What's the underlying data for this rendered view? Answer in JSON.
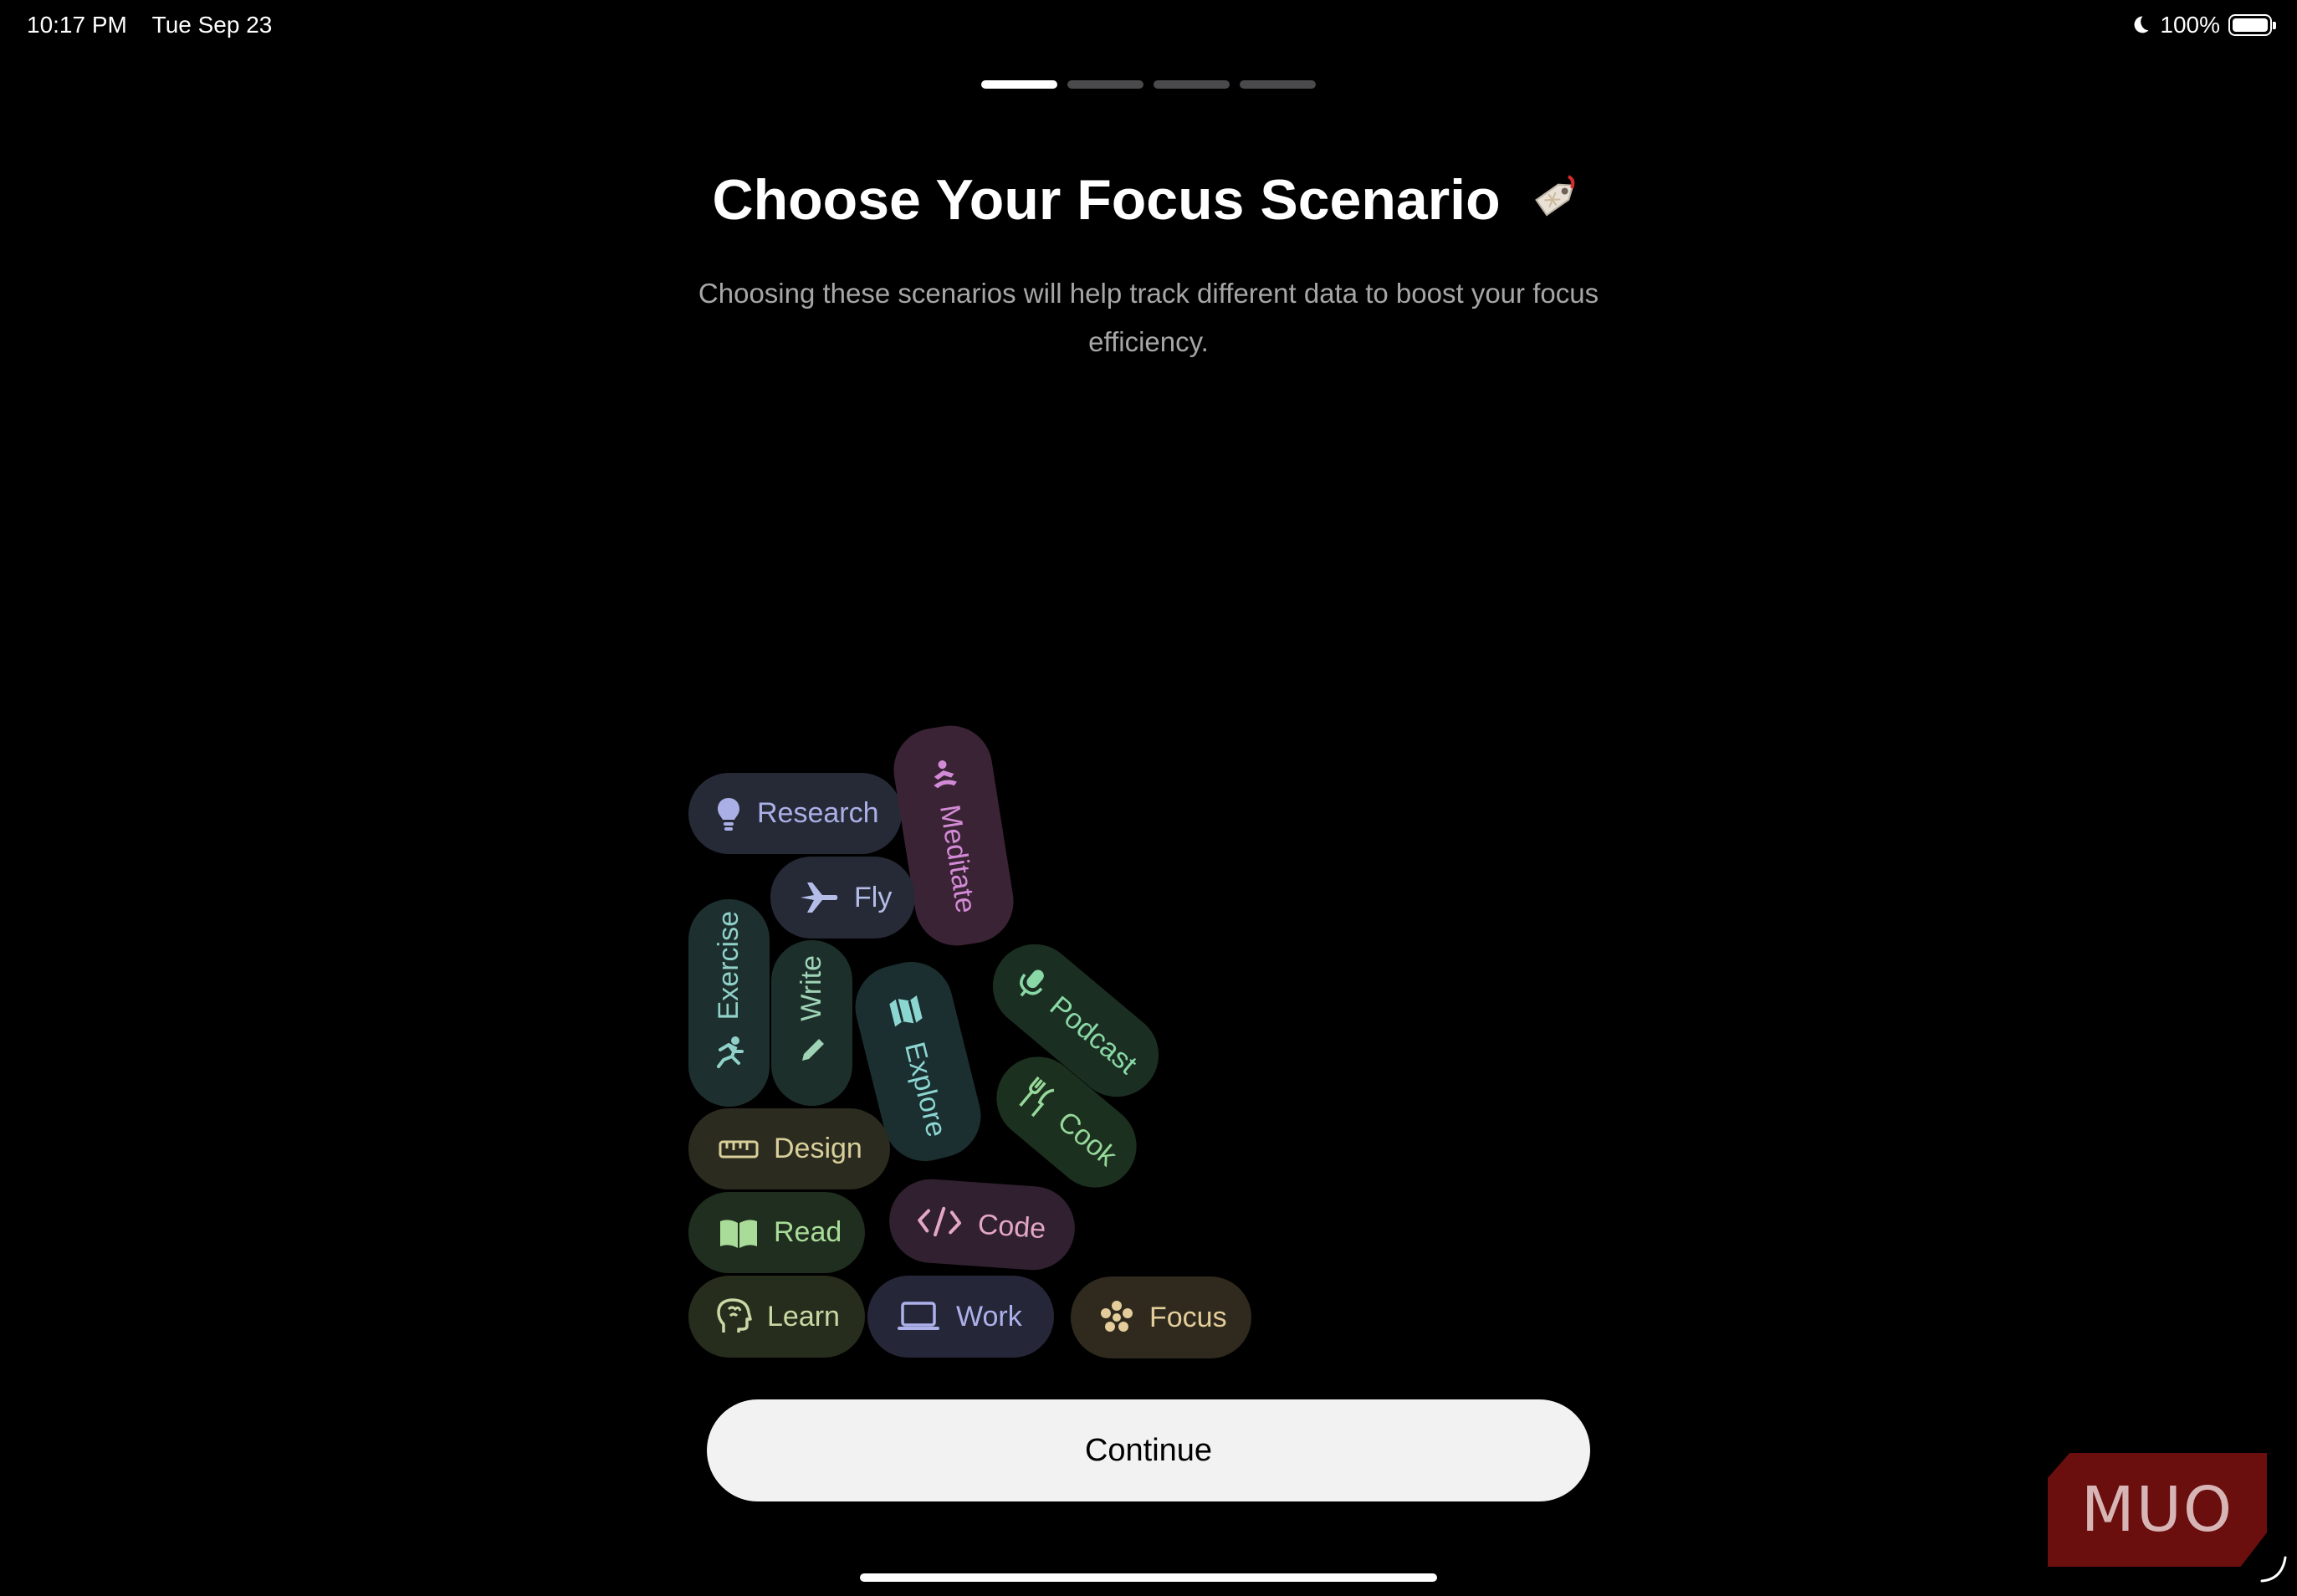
{
  "status_bar": {
    "time": "10:17 PM",
    "date": "Tue Sep 23",
    "battery": "100%",
    "icons": [
      "moon-icon",
      "battery-icon"
    ]
  },
  "pager": {
    "total": 4,
    "current": 1
  },
  "heading": {
    "title": "Choose Your Focus Scenario",
    "title_icon": "tag-icon",
    "subtitle": "Choosing these scenarios will help track different data to boost your focus efficiency."
  },
  "scenarios": [
    {
      "label": "Research",
      "icon": "lightbulb-icon",
      "color": "#aab0e6"
    },
    {
      "label": "Meditate",
      "icon": "lotus-icon",
      "color": "#d38ad6"
    },
    {
      "label": "Fly",
      "icon": "airplane-icon",
      "color": "#b3bde8"
    },
    {
      "label": "Exercise",
      "icon": "running-icon",
      "color": "#8fd0c8"
    },
    {
      "label": "Write",
      "icon": "pencil-icon",
      "color": "#9fd3b6"
    },
    {
      "label": "Explore",
      "icon": "map-icon",
      "color": "#8cd6d2"
    },
    {
      "label": "Podcast",
      "icon": "microphone-icon",
      "color": "#8ad8a6"
    },
    {
      "label": "Cook",
      "icon": "fork-knife-icon",
      "color": "#96d89a"
    },
    {
      "label": "Design",
      "icon": "ruler-icon",
      "color": "#d9cf9a"
    },
    {
      "label": "Read",
      "icon": "book-icon",
      "color": "#a9dc98"
    },
    {
      "label": "Code",
      "icon": "code-icon",
      "color": "#e3a6c3"
    },
    {
      "label": "Learn",
      "icon": "brain-icon",
      "color": "#c9d9a4"
    },
    {
      "label": "Work",
      "icon": "laptop-icon",
      "color": "#aeb0ea"
    },
    {
      "label": "Focus",
      "icon": "dots-icon",
      "color": "#e4cd9b"
    }
  ],
  "actions": {
    "continue_label": "Continue"
  },
  "watermark": "MUO"
}
